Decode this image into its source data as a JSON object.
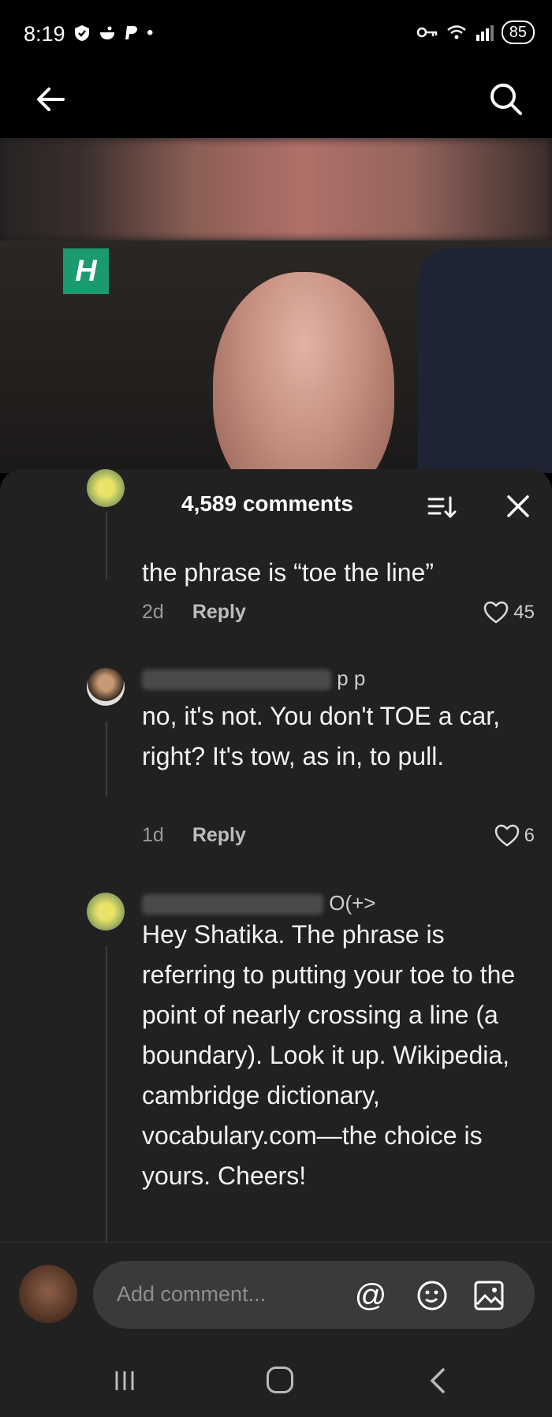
{
  "status_bar": {
    "time": "8:19",
    "battery": "85",
    "dot": "•"
  },
  "comments_header": {
    "count": "4,589 comments"
  },
  "comments": [
    {
      "text": "the phrase is “toe the line”",
      "age": "2d",
      "reply_label": "Reply",
      "likes": "45"
    },
    {
      "username_suffix": "p  p",
      "text": "no, it's not. You don't TOE a car, right? It's tow, as in, to pull.",
      "age": "1d",
      "reply_label": "Reply",
      "likes": "6"
    },
    {
      "username_suffix": "O(+>",
      "text": "Hey Shatika. The phrase is referring to putting your toe to the point of nearly crossing a line (a boundary). Look it up. Wikipedia, cambridge dictionary, vocabulary.com—the choice is yours. Cheers!"
    }
  ],
  "input": {
    "placeholder": "Add comment...",
    "mention_symbol": "@"
  },
  "video": {
    "logo_letter": "H"
  },
  "colors": {
    "sheet": "#212121",
    "logo": "#1a9a6e",
    "text": "#f2f2f2",
    "muted": "#9a9a9a"
  }
}
